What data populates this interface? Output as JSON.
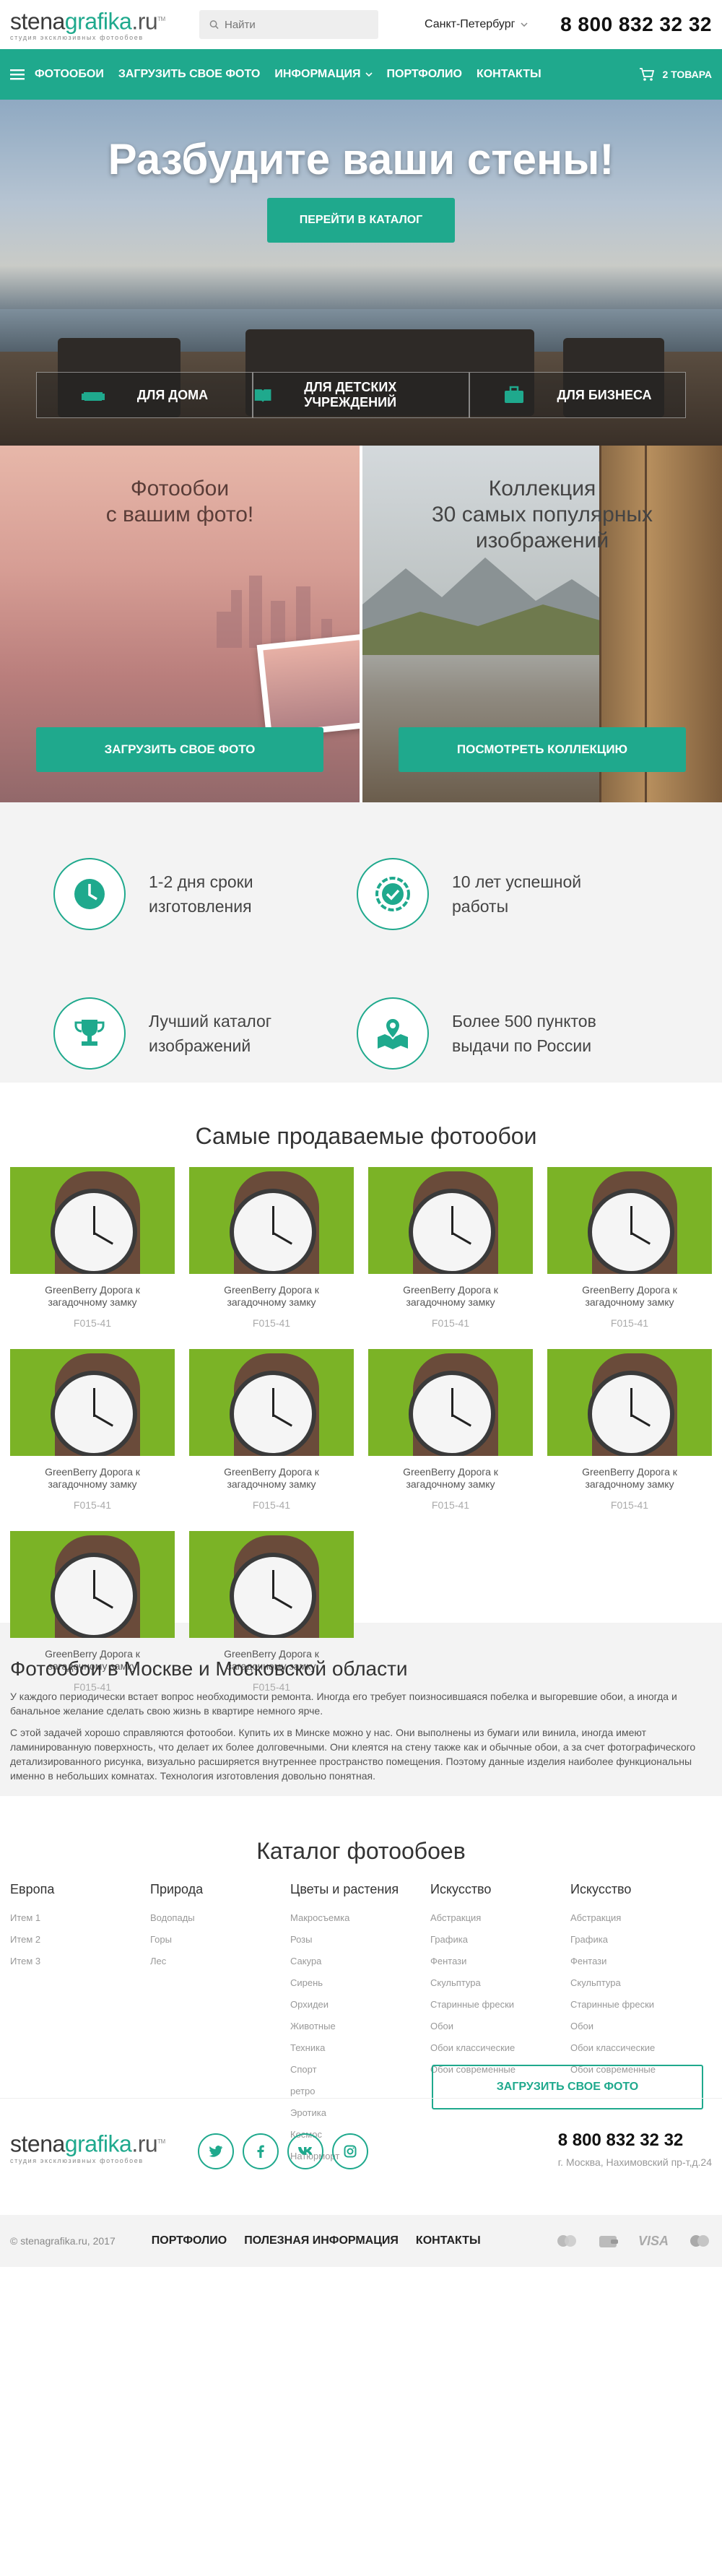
{
  "header": {
    "logo_main": "stena",
    "logo_accent": "grafika",
    "logo_tld": ".ru",
    "logo_tm": "TM",
    "logo_tagline": "студия эксклюзивных фотообоев",
    "search_placeholder": "Найти",
    "city": "Санкт-Петербург",
    "phone": "8 800 832 32 32"
  },
  "nav": {
    "items": [
      "ФОТООБОИ",
      "ЗАГРУЗИТЬ СВОЕ ФОТО",
      "ИНФОРМАЦИЯ",
      "ПОРТФОЛИО",
      "КОНТАКТЫ"
    ],
    "cart": "2 ТОВАРА"
  },
  "hero": {
    "title": "Разбудите ваши стены!",
    "button": "ПЕРЕЙТИ В КАТАЛОГ",
    "tabs": [
      "ДЛЯ ДОМА",
      "ДЛЯ ДЕТСКИХ УЧРЕЖДЕНИЙ",
      "ДЛЯ БИЗНЕСА"
    ]
  },
  "promo": {
    "left_title": "Фотообои\nс вашим фото!",
    "left_button": "ЗАГРУЗИТЬ СВОЕ ФОТО",
    "right_title": "Коллекция\n30 самых популярных\nизображений",
    "right_button": "ПОСМОТРЕТЬ КОЛЛЕКЦИЮ"
  },
  "features": [
    {
      "text": "1-2 дня сроки\nизготовления",
      "icon": "clock-icon"
    },
    {
      "text": "10 лет успешной\nработы",
      "icon": "badge-check-icon"
    },
    {
      "text": "Лучший каталог\nизображений",
      "icon": "trophy-icon"
    },
    {
      "text": "Более 500 пунктов\nвыдачи по России",
      "icon": "map-pin-icon"
    }
  ],
  "bestsellers": {
    "title": "Самые продаваемые фотообои",
    "products": [
      {
        "name": "GreenBerry Дорога к загадочному замку",
        "code": "F015-41"
      },
      {
        "name": "GreenBerry Дорога к загадочному замку",
        "code": "F015-41"
      },
      {
        "name": "GreenBerry Дорога к загадочному замку",
        "code": "F015-41"
      },
      {
        "name": "GreenBerry Дорога к загадочному замку",
        "code": "F015-41"
      },
      {
        "name": "GreenBerry Дорога к загадочному замку",
        "code": "F015-41"
      },
      {
        "name": "GreenBerry Дорога к загадочному замку",
        "code": "F015-41"
      },
      {
        "name": "GreenBerry Дорога к загадочному замку",
        "code": "F015-41"
      },
      {
        "name": "GreenBerry Дорога к загадочному замку",
        "code": "F015-41"
      },
      {
        "name": "GreenBerry Дорога к загадочному замку",
        "code": "F015-41"
      },
      {
        "name": "GreenBerry Дорога к загадочному замку",
        "code": "F015-41"
      }
    ]
  },
  "seo": {
    "title": "Фотообои в Москве и Московской области",
    "p1": "У каждого периодически встает вопрос необходимости ремонта. Иногда его требует поизносившаяся побелка и выгоревшие обои, а иногда и банальное желание сделать свою жизнь в квартире немного ярче.",
    "p2": "С этой задачей хорошо справляются фотообои. Купить их в Минске можно у нас. Они выполнены из бумаги или винила, иногда имеют ламинированную поверхность, что делает их более долговечными. Они клеятся на стену также как и обычные обои, а за счет фотографического детализированного рисунка, визуально расширяется внутреннее пространство помещения. Поэтому данные изделия наиболее функциональны именно в небольших комнатах. Технология изготовления довольно понятная."
  },
  "catalog": {
    "title": "Каталог фотообоев",
    "columns": [
      {
        "title": "Европа",
        "items": [
          "Итем 1",
          "Итем 2",
          "Итем 3"
        ]
      },
      {
        "title": "Природа",
        "items": [
          "Водопады",
          "Горы",
          "Лес"
        ]
      },
      {
        "title": "Цветы и растения",
        "items": [
          "Макросъемка",
          "Розы",
          "Сакура",
          "Сирень",
          "Орхидеи",
          "Животные",
          "Техника",
          "Спорт",
          "ретро",
          "Эротика",
          "Космос",
          "Натюрморт"
        ]
      },
      {
        "title": "Искусство",
        "items": [
          "Абстракция",
          "Графика",
          "Фентази",
          "Скульптура",
          "Старинные фрески",
          "Обои",
          "Обои классические",
          "Обои современные"
        ]
      },
      {
        "title": "Искусство",
        "items": [
          "Абстракция",
          "Графика",
          "Фентази",
          "Скульптура",
          "Старинные фрески",
          "Обои",
          "Обои классические",
          "Обои современные"
        ]
      }
    ],
    "upload_button": "ЗАГРУЗИТЬ СВОЕ ФОТО"
  },
  "footer": {
    "phone": "8 800 832 32 32",
    "address": "г. Москва, Нахимовский пр-т,д.24",
    "copyright": "© stenagrafika.ru, 2017",
    "links": [
      "ПОРТФОЛИО",
      "ПОЛЕЗНАЯ ИНФОРМАЦИЯ",
      "КОНТАКТЫ"
    ],
    "socials": [
      "twitter-icon",
      "facebook-icon",
      "vk-icon",
      "instagram-icon"
    ],
    "payments": [
      "mastercard-icon",
      "wallet-icon",
      "VISA",
      "maestro-icon"
    ]
  },
  "colors": {
    "accent": "#1fa98d"
  }
}
